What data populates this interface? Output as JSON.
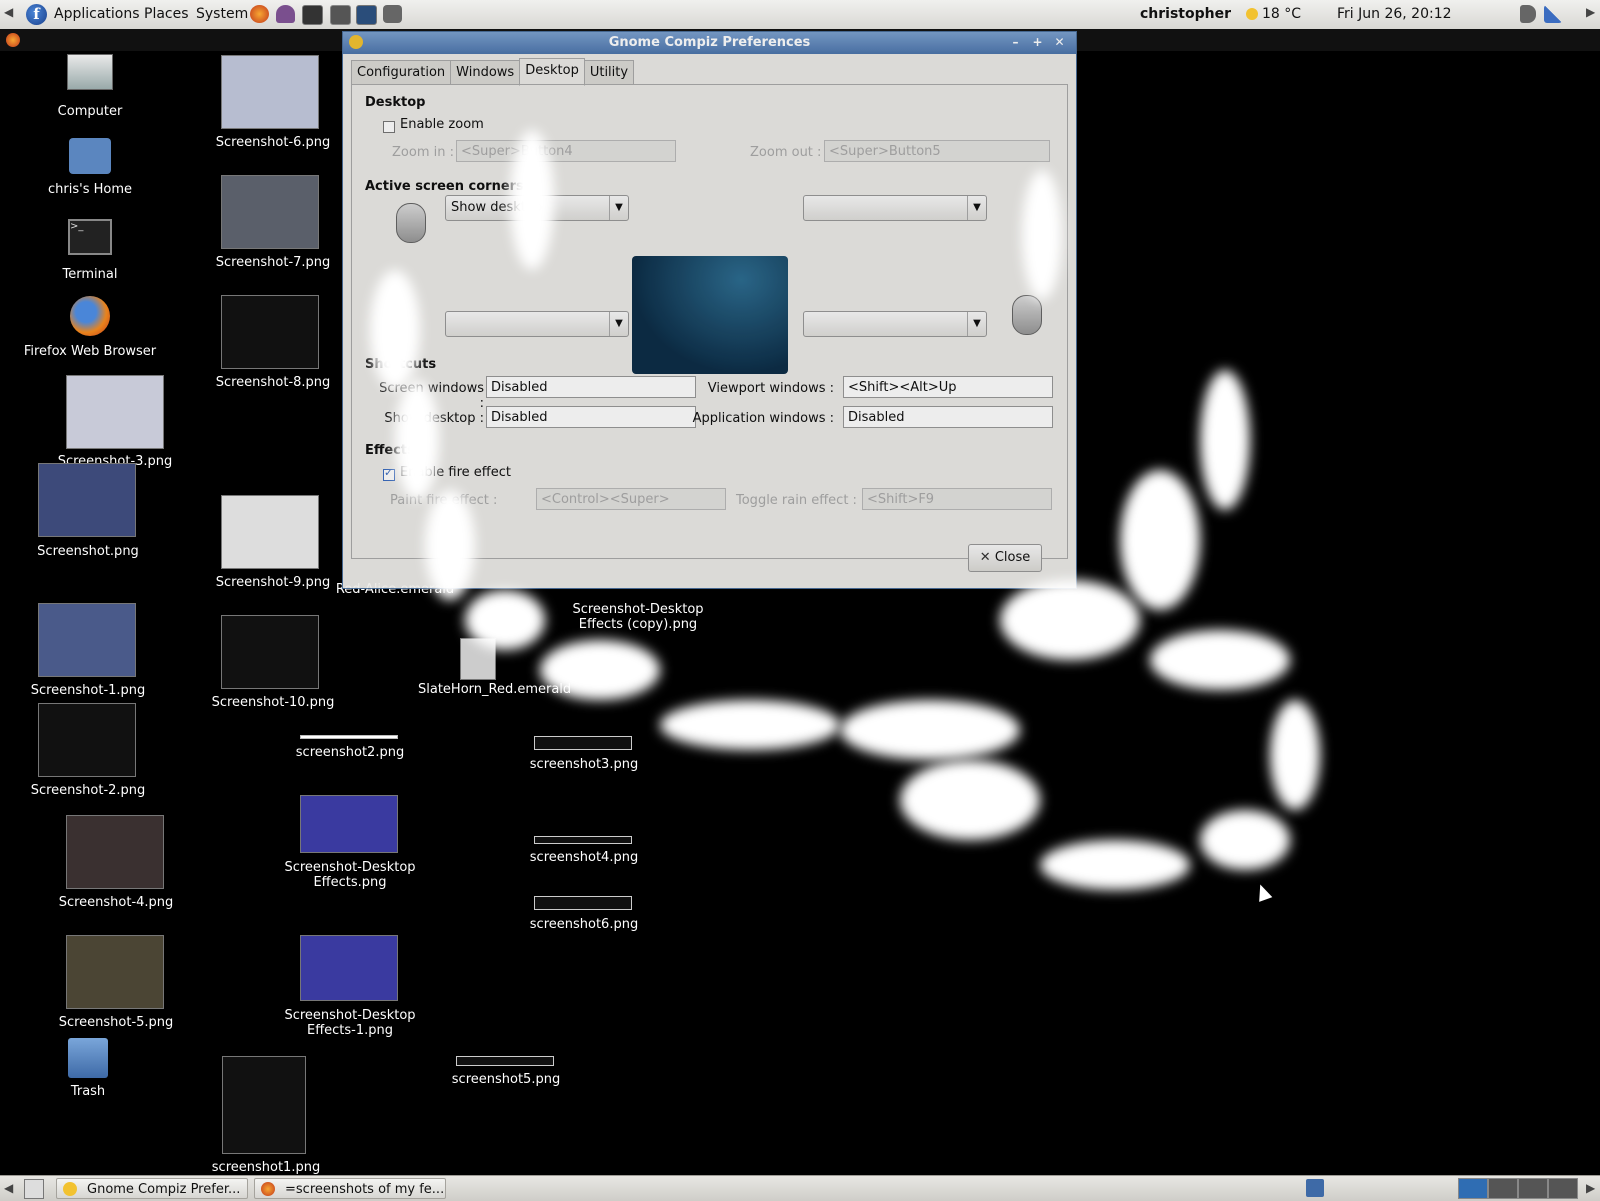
{
  "top_panel": {
    "menus": [
      "Applications",
      "Places",
      "System"
    ],
    "user": "christopher",
    "temperature": "18 °C",
    "clock": "Fri Jun 26, 20:12"
  },
  "desktop_icons": {
    "computer": "Computer",
    "home": "chris's Home",
    "terminal": "Terminal",
    "firefox": "Firefox Web Browser",
    "trash": "Trash",
    "files": [
      "Screenshot-6.png",
      "Screenshot-7.png",
      "Screenshot-8.png",
      "Screenshot-3.png",
      "Screenshot.png",
      "Screenshot-9.png",
      "Screenshot-1.png",
      "Screenshot-10.png",
      "Screenshot-2.png",
      "Screenshot-4.png",
      "Screenshot-5.png",
      "screenshot1.png",
      "screenshot2.png",
      "Screenshot-Desktop Effects.png",
      "Screenshot-Desktop Effects-1.png",
      "screenshot5.png",
      "Red-Alice.emerald",
      "Screenshot-Desktop Effects (copy).png",
      "SlateHorn_Red.emerald",
      "screenshot3.png",
      "screenshot4.png",
      "screenshot6.png"
    ]
  },
  "dialog": {
    "title": "Gnome Compiz Preferences",
    "tabs": [
      "Configuration",
      "Windows",
      "Desktop",
      "Utility"
    ],
    "active_tab": "Desktop",
    "desktop_section": "Desktop",
    "enable_zoom": "Enable zoom",
    "zoom_in_label": "Zoom in :",
    "zoom_in_value": "<Super>Button4",
    "zoom_out_label": "Zoom out :",
    "zoom_out_value": "<Super>Button5",
    "corners_section": "Active screen corners",
    "corner_top_left": "Show desktop",
    "shortcuts_section": "Shortcuts",
    "screen_windows_label": "Screen windows :",
    "screen_windows_value": "Disabled",
    "viewport_windows_label": "Viewport windows :",
    "viewport_windows_value": "<Shift><Alt>Up",
    "show_desktop_label": "Show desktop :",
    "show_desktop_value": "Disabled",
    "application_windows_label": "Application windows :",
    "application_windows_value": "Disabled",
    "effects_section": "Effects",
    "fire_effect_label": "Enable fire effect",
    "paint_fire_label": "Paint fire effect :",
    "paint_fire_value": "<Control><Super>",
    "rain_label": "Toggle rain effect :",
    "rain_value": "<Shift>F9",
    "close_button": "Close"
  },
  "bottom_panel": {
    "task1": "Gnome Compiz Prefer...",
    "task2": "=screenshots of my fe..."
  }
}
